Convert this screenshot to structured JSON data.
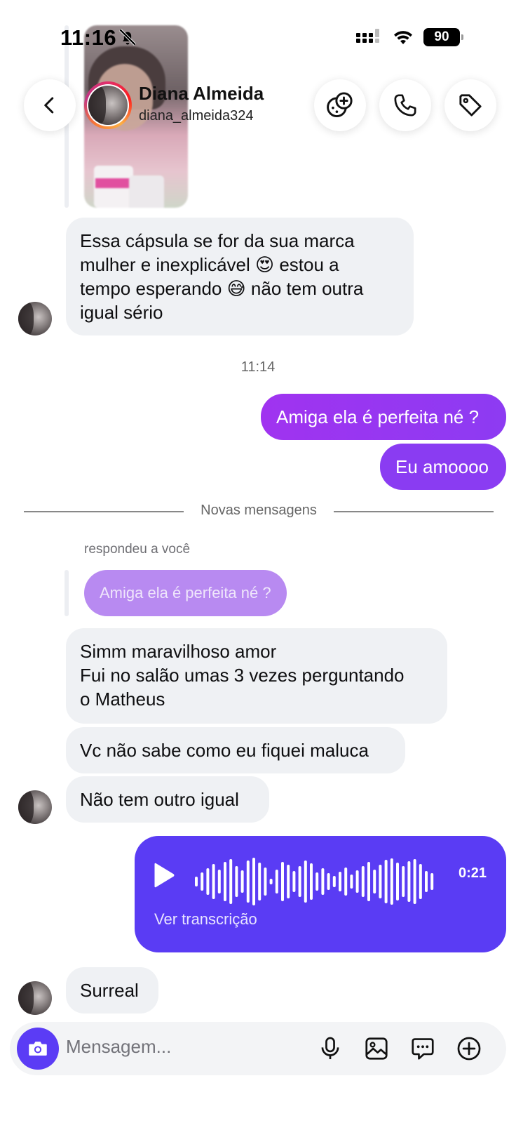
{
  "status_bar": {
    "time": "11:16",
    "battery": "90"
  },
  "header": {
    "name": "Diana Almeida",
    "username": "diana_almeida324"
  },
  "messages": {
    "incoming_1": [
      "Essa cápsula se for  da sua marca",
      "mulher e inexplicável 😍    estou a",
      "tempo esperando 😅  não tem outra",
      "igual sério"
    ],
    "timestamp": "11:14",
    "outgoing_1": "Amiga ela é perfeita né ?",
    "outgoing_2": "Eu amoooo",
    "divider": "Novas mensagens",
    "reply_label": "respondeu a você",
    "reply_quote": "Amiga ela é perfeita né ?",
    "incoming_2": [
      "Simm maravilhoso amor",
      "Fui no salão umas 3 vezes perguntando",
      "o Matheus"
    ],
    "incoming_3": "Vc não sabe como eu fiquei maluca",
    "incoming_4": "Não tem outro igual",
    "voice": {
      "duration": "0:21",
      "transcript_link": "Ver transcrição"
    },
    "incoming_5": "Surreal"
  },
  "composer": {
    "placeholder": "Mensagem..."
  },
  "colors": {
    "outgoing_gradient_start": "#a033f0",
    "outgoing_gradient_end": "#8a3cf2",
    "voice_bubble": "#5a3cf4",
    "incoming_bubble": "#eff1f4"
  },
  "icons": [
    "bell-slash-icon",
    "signal-icon",
    "wifi-icon",
    "battery-icon",
    "back-chevron-icon",
    "game-icon",
    "phone-icon",
    "tag-icon",
    "play-icon",
    "camera-icon",
    "microphone-icon",
    "gallery-icon",
    "sticker-chat-icon",
    "plus-circle-icon"
  ]
}
